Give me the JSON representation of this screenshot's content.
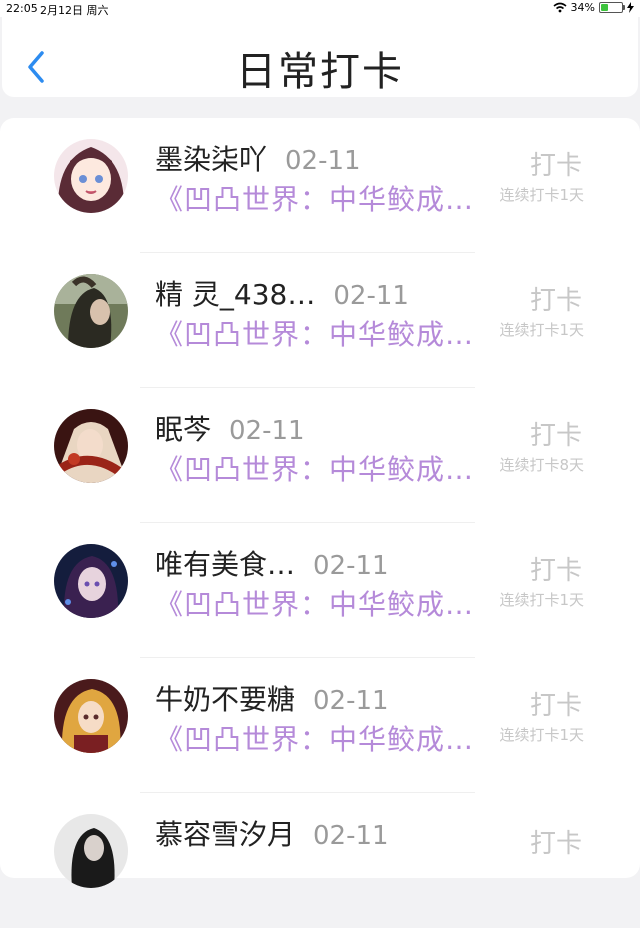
{
  "status_bar": {
    "time": "22:05",
    "date": "2月12日 周六",
    "battery": "34%",
    "battery_level": 0.34
  },
  "header": {
    "title": "日常打卡",
    "back_icon": "chevron-left-icon"
  },
  "colors": {
    "accent": "#2d8cf0",
    "book_title": "#b58ad9",
    "muted": "#9a9a9a"
  },
  "entries": [
    {
      "name": "墨染柒吖",
      "date": "02-11",
      "book": "《凹凸世界：中华鲛成…",
      "action": "打卡",
      "streak": "连续打卡1天"
    },
    {
      "name": "精 灵_438…",
      "date": "02-11",
      "book": "《凹凸世界：中华鲛成…",
      "action": "打卡",
      "streak": "连续打卡1天"
    },
    {
      "name": "眠芩",
      "date": "02-11",
      "book": "《凹凸世界：中华鲛成…",
      "action": "打卡",
      "streak": "连续打卡8天"
    },
    {
      "name": "唯有美食…",
      "date": "02-11",
      "book": "《凹凸世界：中华鲛成…",
      "action": "打卡",
      "streak": "连续打卡1天"
    },
    {
      "name": "牛奶不要糖",
      "date": "02-11",
      "book": "《凹凸世界：中华鲛成…",
      "action": "打卡",
      "streak": "连续打卡1天"
    },
    {
      "name": "慕容雪汐月",
      "date": "02-11",
      "book": "",
      "action": "打卡",
      "streak": ""
    }
  ]
}
